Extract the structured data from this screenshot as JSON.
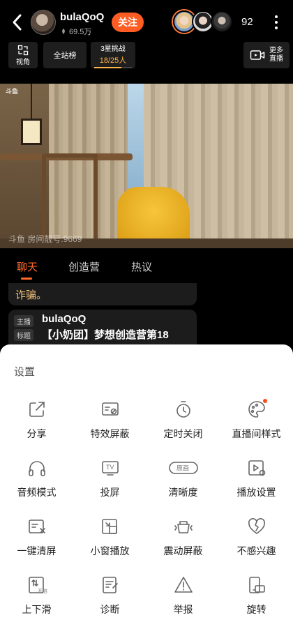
{
  "header": {
    "host_name": "bulaQoQ",
    "fans": "69.5万",
    "follow_label": "关注",
    "viewer_count": "92"
  },
  "toolbar": {
    "view_label": "视角",
    "rank_label": "全站榜",
    "challenge_title": "3星挑战",
    "challenge_progress": "18/25人",
    "challenge_fraction": 0.72,
    "more_live_line1": "更多",
    "more_live_line2": "直播"
  },
  "video": {
    "logo": "斗鱼",
    "watermark": "斗鱼 房间靓号:9669"
  },
  "tabs": [
    {
      "label": "聊天",
      "active": true
    },
    {
      "label": "创造营",
      "active": false
    },
    {
      "label": "热议",
      "active": false
    }
  ],
  "chat": {
    "message": "诈骗。",
    "card": {
      "tag_host": "主播",
      "host_name": "bulaQoQ",
      "tag_title": "标题",
      "title": "【小奶团】梦想创造营第18"
    }
  },
  "settings": {
    "title": "设置",
    "items": [
      {
        "label": "分享",
        "icon": "share-icon"
      },
      {
        "label": "特效屏蔽",
        "icon": "effects-block-icon"
      },
      {
        "label": "定时关闭",
        "icon": "timer-icon"
      },
      {
        "label": "直播间样式",
        "icon": "palette-icon",
        "badge": true
      },
      {
        "label": "音频模式",
        "icon": "headphones-icon"
      },
      {
        "label": "投屏",
        "icon": "tv-cast-icon"
      },
      {
        "label": "清晰度",
        "icon": "quality-icon",
        "icon_text": "原画"
      },
      {
        "label": "播放设置",
        "icon": "play-settings-icon"
      },
      {
        "label": "一键清屏",
        "icon": "clear-screen-icon"
      },
      {
        "label": "小窗播放",
        "icon": "mini-window-icon"
      },
      {
        "label": "震动屏蔽",
        "icon": "vibration-block-icon"
      },
      {
        "label": "不感兴趣",
        "icon": "broken-heart-icon"
      },
      {
        "label": "上下滑",
        "icon": "swipe-icon",
        "icon_text": "开启"
      },
      {
        "label": "诊断",
        "icon": "diagnose-icon"
      },
      {
        "label": "举报",
        "icon": "report-icon"
      },
      {
        "label": "旋转",
        "icon": "rotate-icon"
      }
    ]
  },
  "colors": {
    "accent": "#ff5d23",
    "challenge": "#ffb44a"
  }
}
